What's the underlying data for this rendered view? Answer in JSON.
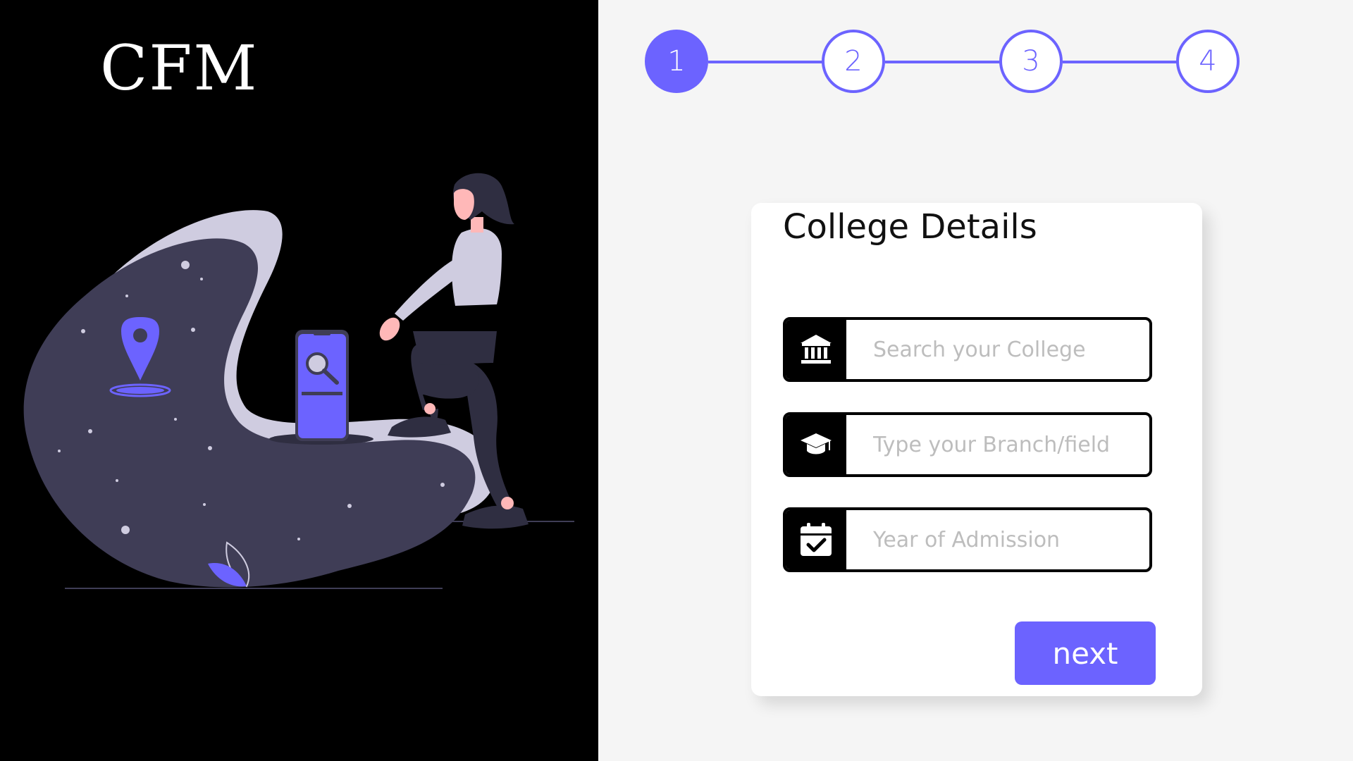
{
  "brand": {
    "logo_text": "CFM"
  },
  "colors": {
    "accent": "#6C63FF",
    "illustration_dark": "#3F3D56",
    "illustration_light": "#CFCCE0",
    "skin": "#FFB8B8",
    "hair": "#2F2E41"
  },
  "stepper": {
    "steps": [
      {
        "label": "1",
        "state": "active"
      },
      {
        "label": "2",
        "state": "inactive"
      },
      {
        "label": "3",
        "state": "inactive"
      },
      {
        "label": "4",
        "state": "inactive"
      }
    ]
  },
  "form": {
    "title": "College Details",
    "fields": [
      {
        "icon": "bank-icon",
        "placeholder": "Search your College",
        "value": ""
      },
      {
        "icon": "graduation-cap-icon",
        "placeholder": "Type your Branch/field",
        "value": ""
      },
      {
        "icon": "calendar-check-icon",
        "placeholder": "Year of Admission",
        "value": ""
      }
    ],
    "next_label": "next"
  }
}
